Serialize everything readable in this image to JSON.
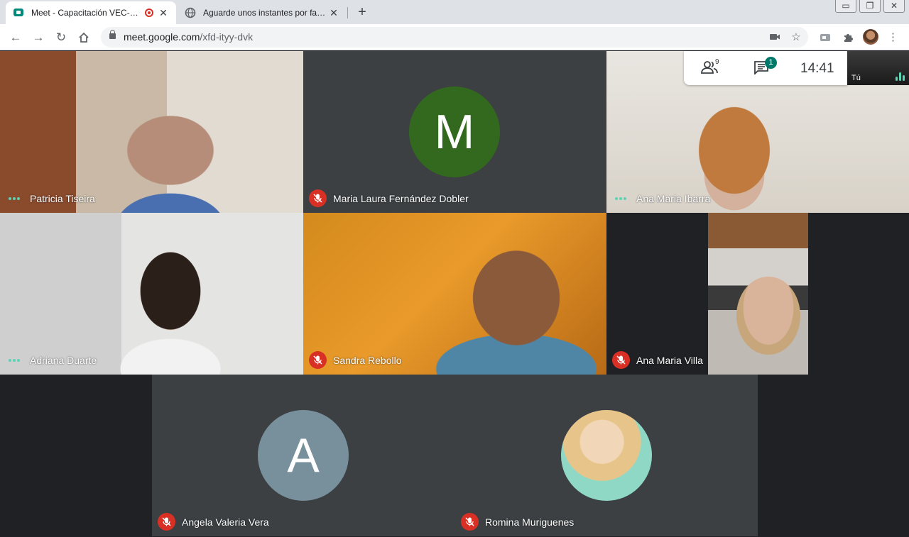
{
  "browser": {
    "tabs": [
      {
        "title": "Meet - Capacitación VEC-EDUCA",
        "active": true,
        "recording": true,
        "close": "✕"
      },
      {
        "title": "Aguarde unos instantes por favor...",
        "active": false,
        "close": "✕"
      }
    ],
    "new_tab": "+",
    "window": {
      "minimize": "▭",
      "restore": "❐",
      "close": "✕"
    },
    "url_host": "meet.google.com",
    "url_path": "/xfd-ityy-dvk"
  },
  "meeting": {
    "participant_count": "9",
    "chat_badge": "1",
    "time": "14:41",
    "self_label": "Tú",
    "participants": [
      {
        "name": "Patricia Tiseira",
        "status": "speaking"
      },
      {
        "name": "Maria Laura Fernández Dobler",
        "status": "muted",
        "initial": "M",
        "avatar_color": "#33691e"
      },
      {
        "name": "Ana Maria Ibarra",
        "status": "speaking"
      },
      {
        "name": "Adriana Duarte",
        "status": "speaking"
      },
      {
        "name": "Sandra Rebollo",
        "status": "muted"
      },
      {
        "name": "Ana Maria Villa",
        "status": "muted"
      },
      {
        "name": "Angela Valeria Vera",
        "status": "muted",
        "initial": "A",
        "avatar_color": "#78909c"
      },
      {
        "name": "Romina Muriguenes",
        "status": "muted"
      }
    ]
  },
  "colors": {
    "mute_red": "#d93025",
    "stage": "#202124",
    "tile_dark": "#3c4043"
  }
}
